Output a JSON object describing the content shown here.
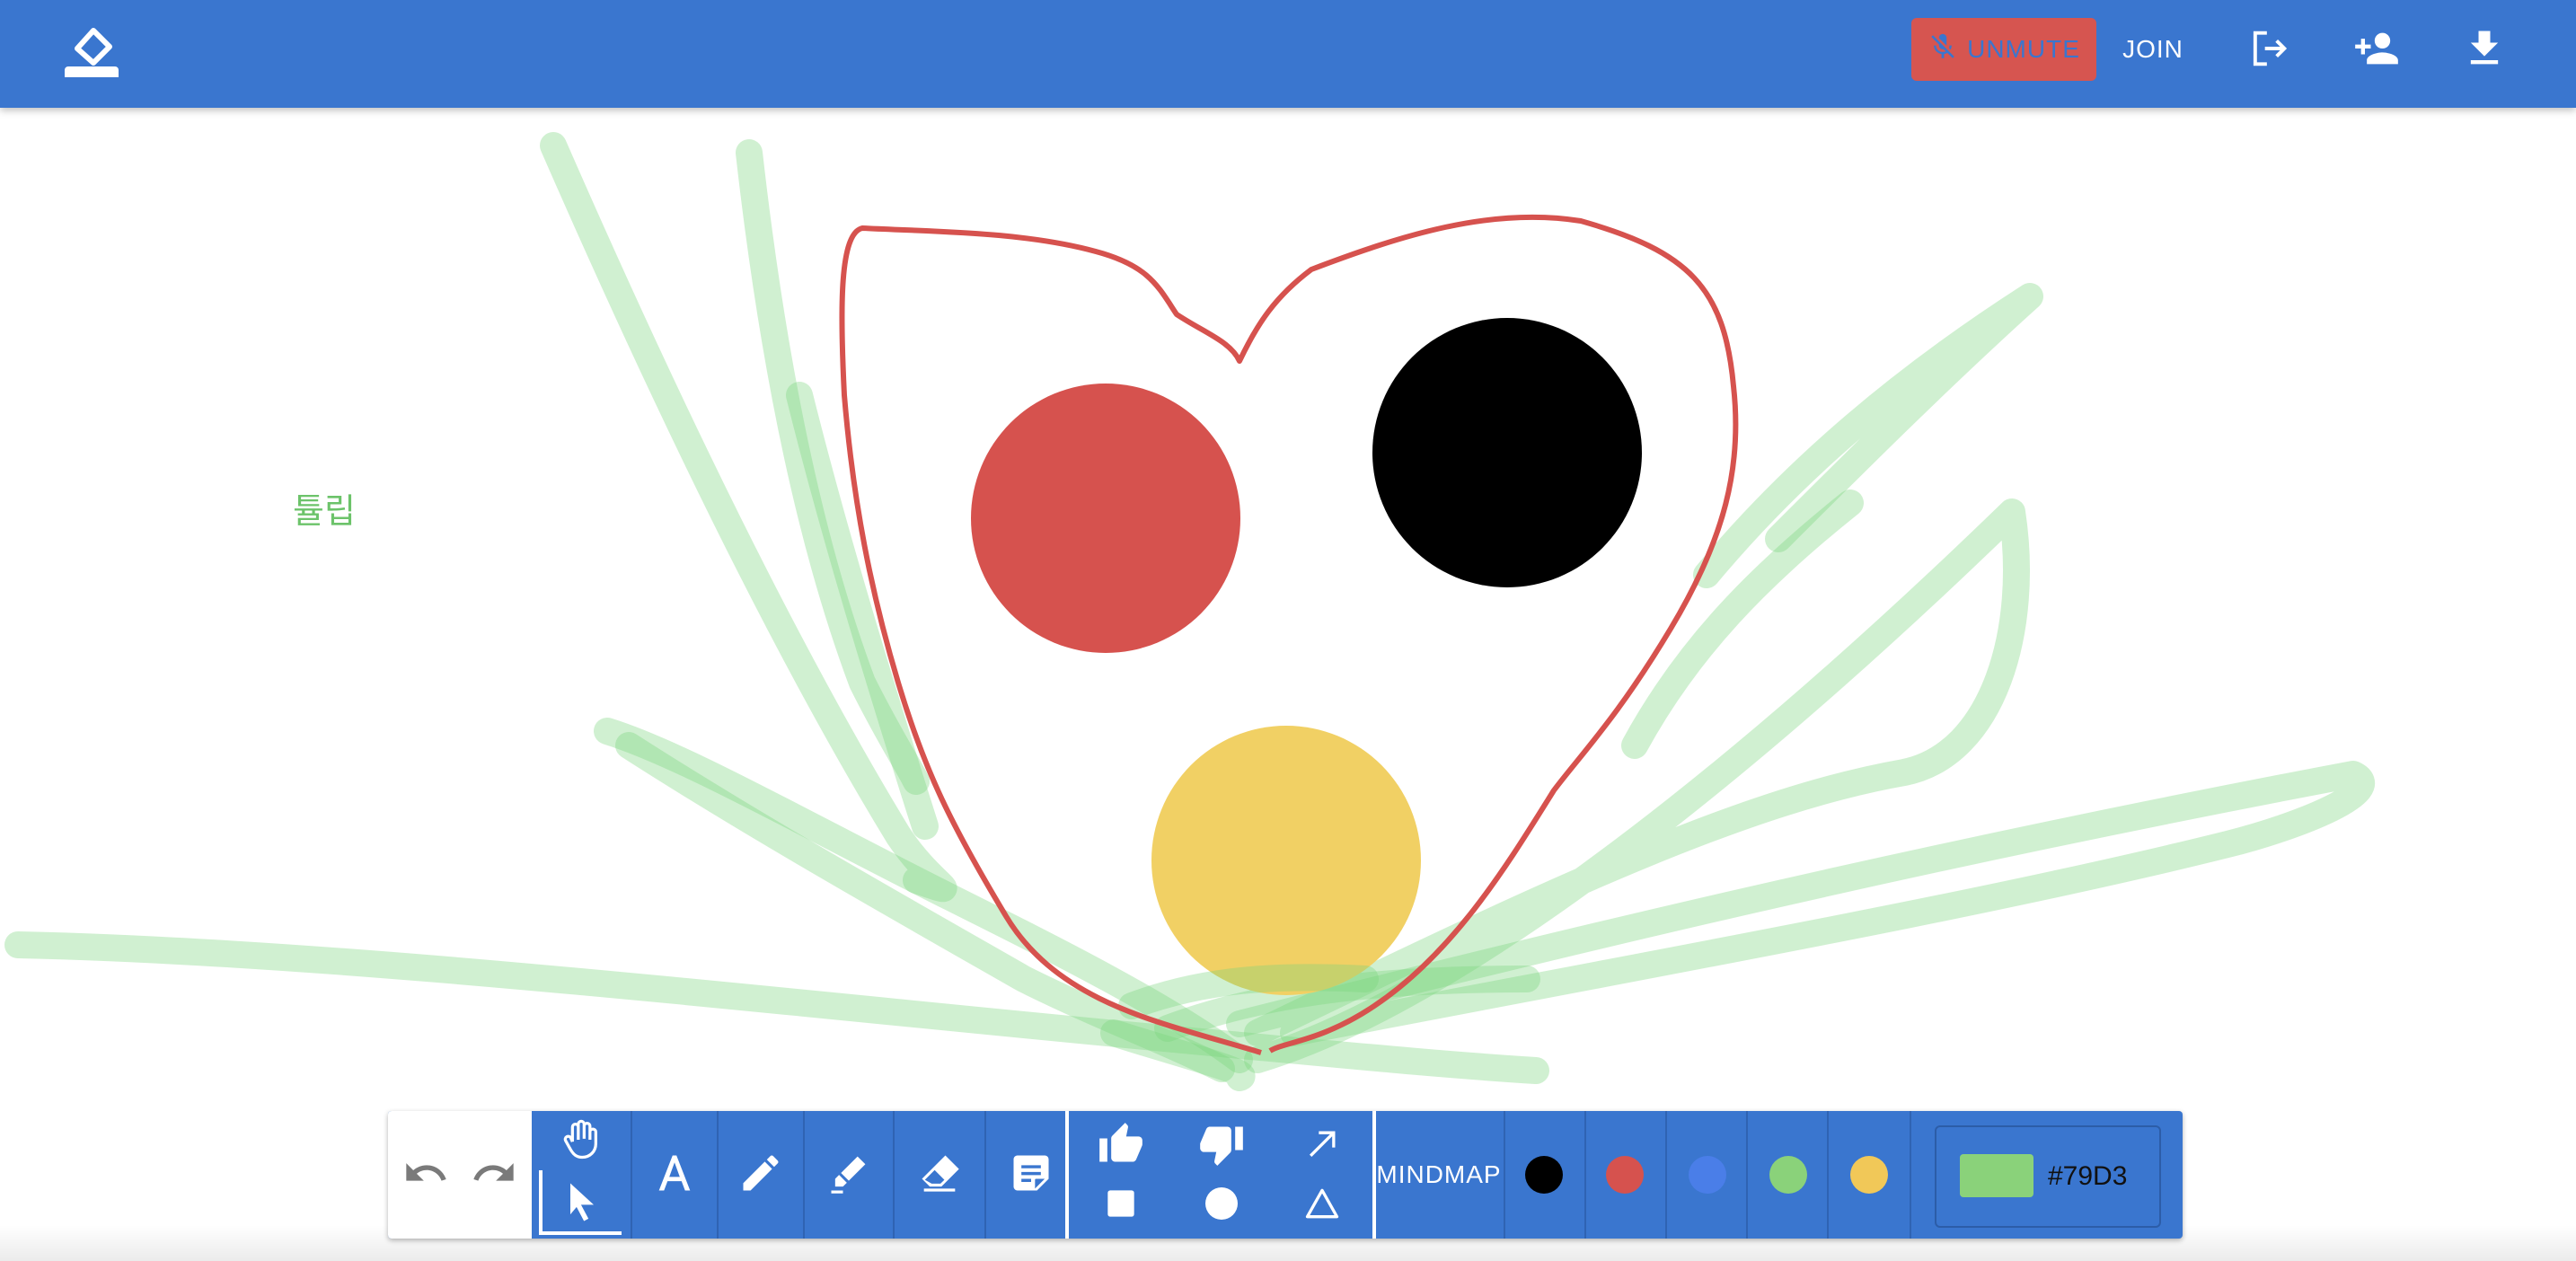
{
  "header": {
    "unmute_label": "UNMUTE",
    "join_label": "JOIN",
    "icons": [
      "eraser-logo-icon",
      "mic-off-icon",
      "logout-icon",
      "add-person-icon",
      "download-icon"
    ],
    "colors": {
      "bar": "#3a76cf",
      "unmute_bg": "#d65550"
    }
  },
  "canvas": {
    "label": "튤립",
    "shapes": [
      {
        "kind": "circle",
        "color": "#d6524e"
      },
      {
        "kind": "circle",
        "color": "#000000"
      },
      {
        "kind": "circle",
        "color": "#f1d064"
      },
      {
        "kind": "freehand",
        "color": "#d6524e"
      },
      {
        "kind": "highlighter",
        "color": "#79D37A"
      }
    ]
  },
  "toolbar": {
    "tools": [
      "undo",
      "redo",
      "hand",
      "pointer",
      "text",
      "pen",
      "highlighter",
      "eraser",
      "sticky-note"
    ],
    "stamps": [
      "thumbs-up",
      "thumbs-down",
      "arrow",
      "square",
      "circle",
      "triangle"
    ],
    "mindmap_label": "MINDMAP",
    "palette": [
      {
        "name": "black",
        "color": "#000000"
      },
      {
        "name": "red",
        "color": "#d6524e"
      },
      {
        "name": "blue",
        "color": "#4a7ee8"
      },
      {
        "name": "green",
        "color": "#8ad27a"
      },
      {
        "name": "yellow",
        "color": "#f1c858"
      }
    ],
    "current_color": {
      "hex_label": "#79D3",
      "swatch": "#8ad27a"
    }
  }
}
